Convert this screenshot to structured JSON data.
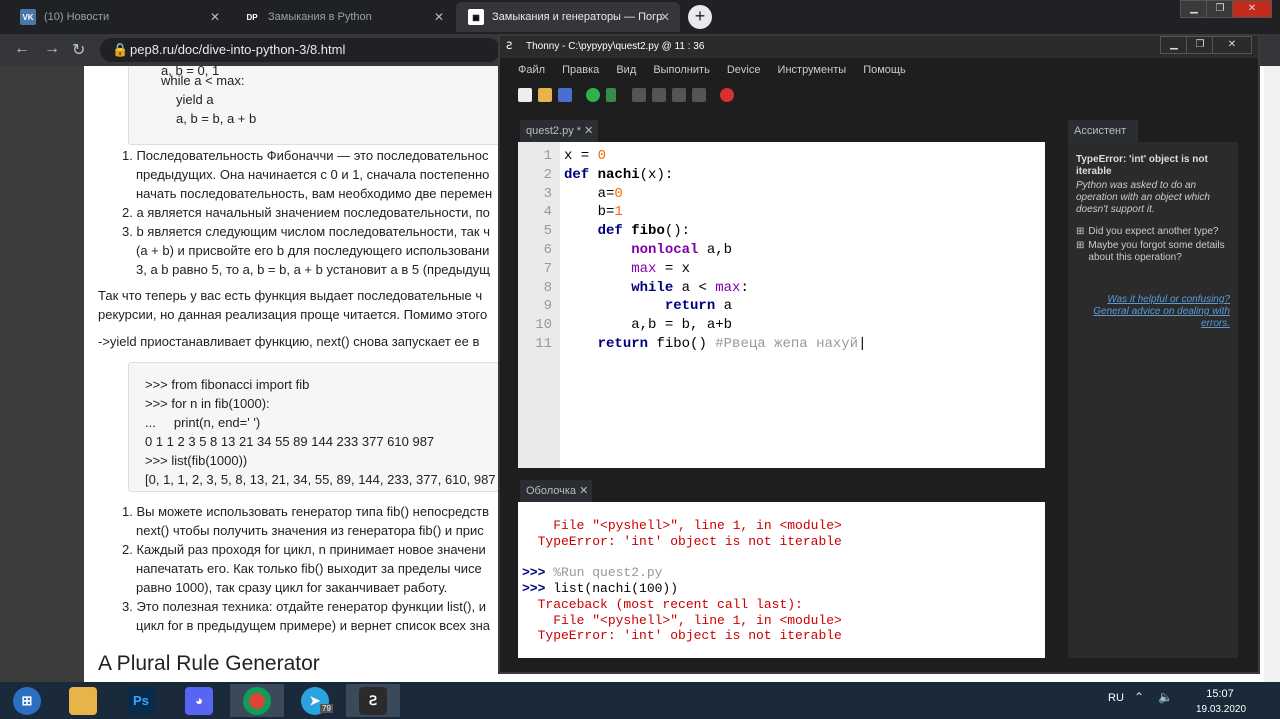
{
  "browser": {
    "tabs": [
      {
        "label": "(10) Новости",
        "icon": "vk-icon"
      },
      {
        "label": "Замыкания в Python",
        "icon": "dp-icon"
      },
      {
        "label": "Замыкания и генераторы — Погр",
        "icon": "pep8-icon"
      }
    ],
    "url": "pep8.ru/doc/dive-into-python-3/8.html"
  },
  "page": {
    "code_top": [
      "a, b = 0, 1",
      "while a < max:",
      "yield a",
      "a, b = b, a + b"
    ],
    "list1": [
      "1. Последовательность Фибоначчи — это последовательнос",
      "предыдущих. Она начинается с 0 и 1, сначала постепенно",
      "начать последовательность, вам необходимо две перемен",
      "2. a является начальный значением последовательности, по",
      "3. b является следующим числом последовательности, так ч",
      "(a + b) и присвойте его b для последующего использовани",
      "3, a b равно 5, то a, b = b, a + b установит a в 5 (предыдущ"
    ],
    "para1": [
      "Так что теперь у вас есть функция выдает последовательные ч",
      "рекурсии, но данная реализация проще читается. Помимо этого"
    ],
    "para2": "->yield приостанавливает функцию, next() снова запускает ее в",
    "code2": [
      ">>> from fibonacci import fib",
      ">>> for n in fib(1000):",
      "...     print(n, end=' ')",
      "0 1 1 2 3 5 8 13 21 34 55 89 144 233 377 610 987",
      ">>> list(fib(1000))",
      "[0, 1, 1, 2, 3, 5, 8, 13, 21, 34, 55, 89, 144, 233, 377, 610, 987"
    ],
    "list2": [
      "1. Вы можете использовать генератор типа fib() непосредств",
      "next() чтобы получить значения из генератора fib() и прис",
      "2. Каждый раз проходя for цикл, n принимает новое значени",
      "напечатать его. Как только fib() выходит за пределы чисе",
      "равно 1000), так сразу цикл for заканчивает работу.",
      "3. Это полезная техника: отдайте генератор функции list(), и",
      "цикл for в предыдущем примере) и вернет список всех зна"
    ],
    "heading": "A Plural Rule Generator"
  },
  "thonny": {
    "title": "Thonny  -  C:\\pyрypy\\quest2.py  @  11 : 36",
    "menu": [
      "Файл",
      "Правка",
      "Вид",
      "Выполнить",
      "Device",
      "Инструменты",
      "Помощь"
    ],
    "editor_tab": "quest2.py *",
    "line_numbers": [
      "1",
      "2",
      "3",
      "4",
      "5",
      "6",
      "7",
      "8",
      "9",
      "10",
      "11"
    ],
    "shell_tab": "Оболочка",
    "shell": {
      "l1": "    File \"<pyshell>\", line 1, in <module>",
      "l2": "  TypeError: 'int' object is not iterable",
      "p1": ">>>",
      "c1": "%Run quest2.py",
      "p2": ">>>",
      "c2": "list(nachi(100))",
      "l3": "  Traceback (most recent call last):",
      "l4": "    File \"<pyshell>\", line 1, in <module>",
      "l5": "  TypeError: 'int' object is not iterable",
      "p3": ">>>"
    },
    "assistant": {
      "tab": "Ассистент",
      "err_title": "TypeError: 'int' object is not iterable",
      "err_desc": "Python was asked to do an operation with an object which doesn't support it.",
      "q1": "Did you expect another type?",
      "q2": "Maybe you forgot some details about this operation?",
      "link1": "Was it helpful or confusing?",
      "link2": "General advice on dealing with errors."
    }
  },
  "taskbar": {
    "lang": "RU",
    "time": "15:07",
    "date": "19.03.2020",
    "telegram_badge": "79"
  }
}
